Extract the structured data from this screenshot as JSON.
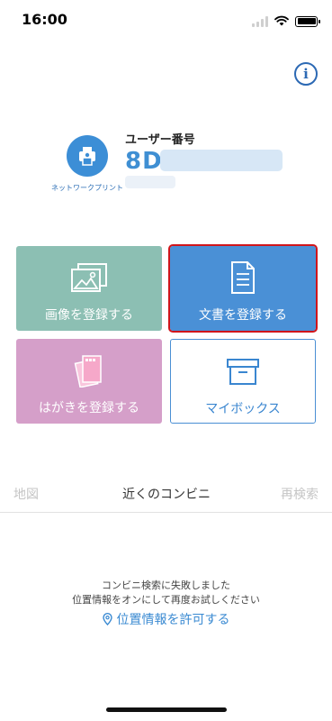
{
  "status_bar": {
    "time": "16:00"
  },
  "profile": {
    "logo_caption": "ネットワークプリント",
    "user_label": "ユーザー番号",
    "user_number_prefix": "8D"
  },
  "tiles": {
    "image": {
      "label": "画像を登録する"
    },
    "document": {
      "label": "文書を登録する"
    },
    "postcard": {
      "label": "はがきを登録する"
    },
    "mybox": {
      "label": "マイボックス"
    }
  },
  "tabs": {
    "map": "地図",
    "nearby": "近くのコンビニ",
    "research": "再検索"
  },
  "messages": {
    "line1": "コンビニ検索に失敗しました",
    "line2": "位置情報をオンにして再度お試しください",
    "permit_link": "位置情報を許可する"
  },
  "colors": {
    "accent_blue": "#4a90d6",
    "image_tile": "#8cbfb3",
    "postcard_tile": "#d59fc9",
    "selection_outline": "#d0151b"
  }
}
